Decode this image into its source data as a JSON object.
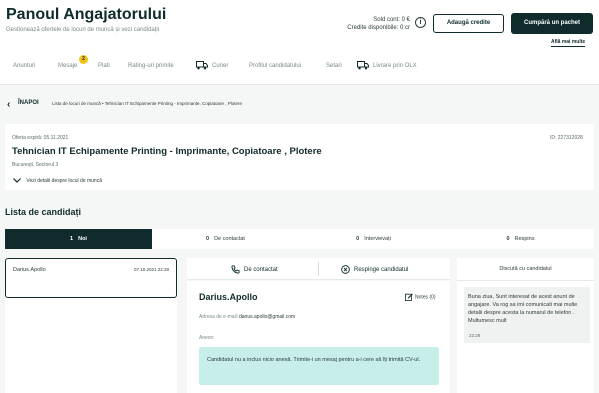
{
  "header": {
    "title": "Panoul Angajatorului",
    "subtitle": "Gestionează ofertele de locuri de muncă și vezi candidații",
    "balance_label": "Sold cont: 0 €",
    "credits_label": "Credite disponibile: 0 cr",
    "add_credits_button": "Adaugă credite",
    "buy_package_button": "Cumpără un pachet",
    "more_link": "Află mai multe"
  },
  "nav": {
    "items": [
      "Anunturi",
      "Mesaje",
      "Plati",
      "Rating-uri primite",
      "Curier",
      "Profilul candidatului",
      "Setari",
      "Livrare prin OLX"
    ],
    "messages_badge": "2"
  },
  "breadcrumb": {
    "back_label": "ÎNAPOI",
    "path": "Lista de locuri de muncă  •  Tehnician IT Echipamente Printing - Imprimante, Copiatoare , Plotere"
  },
  "job": {
    "expires": "Oferta expiră: 05.11.2021",
    "id": "ID: 227312028",
    "title": "Tehnician IT Echipamente Printing - Imprimante, Copiatoare , Plotere",
    "location": "București, Sectorul 3",
    "more_details": "Vezi detalii despre locul de muncă"
  },
  "candidates": {
    "section_title": "Lista de candidați",
    "tabs": [
      {
        "count": "1",
        "label": "Noi"
      },
      {
        "count": "0",
        "label": "De contactat"
      },
      {
        "count": "0",
        "label": "Intervievați"
      },
      {
        "count": "0",
        "label": "Respins"
      }
    ],
    "list": [
      {
        "name": "Darius.Apollo",
        "date": "07.10.2021 22:28"
      }
    ]
  },
  "actions": {
    "contact": "De contactat",
    "reject": "Respinge candidatul"
  },
  "detail": {
    "name": "Darius.Apollo",
    "notes": "Notes (0)",
    "email_label": "Adresa de e-mail:",
    "email_value": "darius.apollo@gmail.com",
    "attachments_label": "Anexe:",
    "no_attachment_notice": "Candidatul nu a inclus nicio anexă. Trimite-i un mesaj pentru a-i cere să îți trimită CV-ul."
  },
  "chat": {
    "title": "Discută cu candidatul",
    "message": "Buna ziua, Sunt interesat de acest anunt de angajare. Va rog sa imi comunicati mai multe detalii despre acesta la numarul de telefon . Multumesc mult",
    "time": "22:28"
  }
}
